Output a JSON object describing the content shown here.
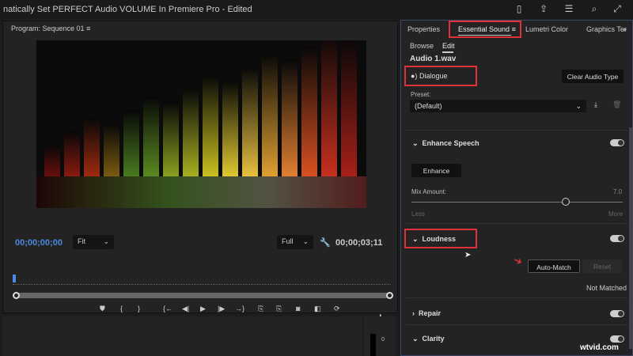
{
  "window": {
    "title": "natically Set PERFECT Audio VOLUME In Premiere Pro - Edited"
  },
  "program": {
    "title": "Program: Sequence 01",
    "menu": "≡",
    "timecode_in": "00;00;00;00",
    "timecode_out": "00;00;03;11",
    "fit": "Fit",
    "quality": "Full"
  },
  "controls": [
    "⛊",
    "{",
    "}",
    "{←",
    "◀|",
    "▶",
    "|▶",
    "→}",
    "⎘",
    "⎘",
    "◙",
    "◧",
    "⟳"
  ],
  "controls_row2": [
    "┏",
    "#"
  ],
  "add": "+",
  "meter": {
    "zero": "0"
  },
  "panel": {
    "tabs": [
      "Properties",
      "Essential Sound",
      "Lumetri Color",
      "Graphics Ter",
      "»"
    ],
    "tab_menu": "≡",
    "subtabs": [
      "Browse",
      "Edit"
    ],
    "clip": "Audio 1.wav",
    "audio_type": "Dialogue",
    "clear": "Clear Audio Type",
    "preset_label": "Preset:",
    "preset": "(Default)",
    "enhance_speech": "Enhance Speech",
    "enhance_btn": "Enhance",
    "mix_label": "Mix Amount:",
    "mix_value": "7.0",
    "mix_fraction": 0.73,
    "less": "Less",
    "more": "More",
    "loudness": "Loudness",
    "auto_match": "Auto-Match",
    "reset": "Reset",
    "status": "Not Matched",
    "repair": "Repair",
    "clarity": "Clarity"
  },
  "watermark": "wtvid.com"
}
